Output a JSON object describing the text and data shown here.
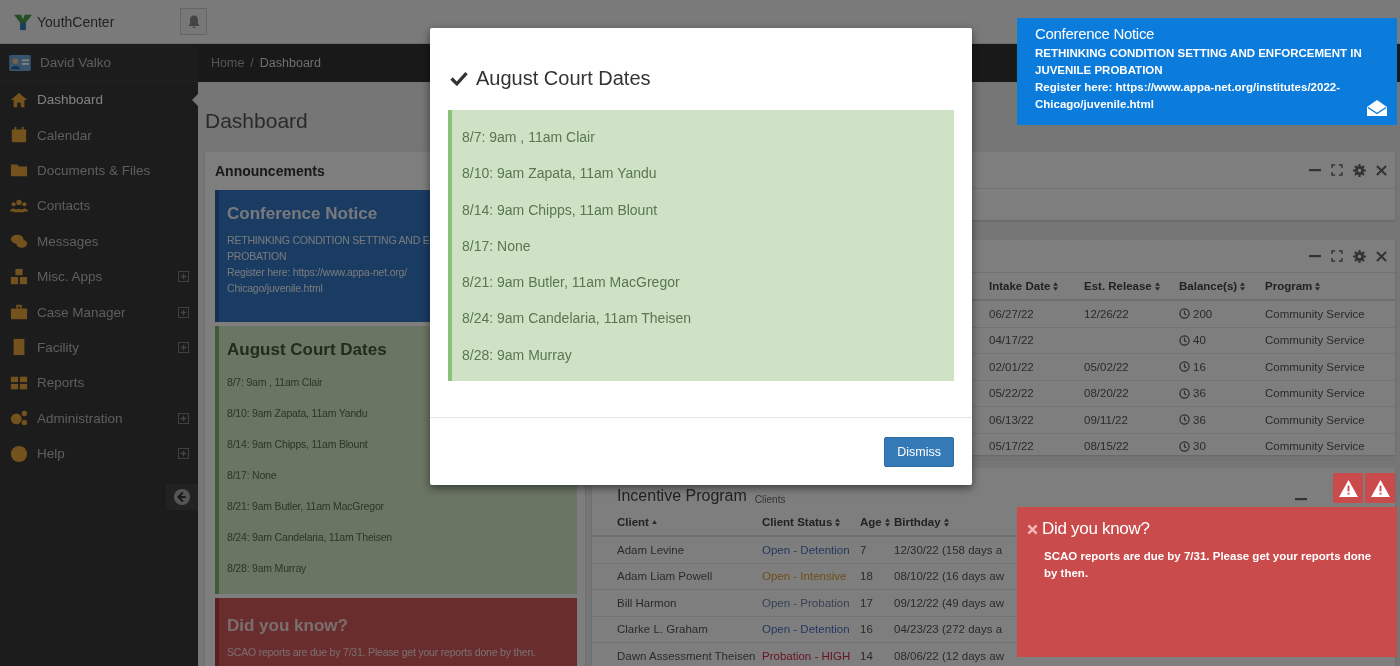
{
  "app": {
    "name": "YouthCenter"
  },
  "user": {
    "name": "David Valko"
  },
  "sidebar": {
    "items": [
      {
        "label": "Dashboard",
        "selected": true,
        "expandable": false
      },
      {
        "label": "Calendar",
        "selected": false,
        "expandable": false
      },
      {
        "label": "Documents & Files",
        "selected": false,
        "expandable": false
      },
      {
        "label": "Contacts",
        "selected": false,
        "expandable": false
      },
      {
        "label": "Messages",
        "selected": false,
        "expandable": false
      },
      {
        "label": "Misc. Apps",
        "selected": false,
        "expandable": true
      },
      {
        "label": "Case Manager",
        "selected": false,
        "expandable": true
      },
      {
        "label": "Facility",
        "selected": false,
        "expandable": true
      },
      {
        "label": "Reports",
        "selected": false,
        "expandable": false
      },
      {
        "label": "Administration",
        "selected": false,
        "expandable": true
      },
      {
        "label": "Help",
        "selected": false,
        "expandable": true
      }
    ]
  },
  "breadcrumb": {
    "items": [
      "Home",
      "Dashboard"
    ],
    "separator": "/"
  },
  "page_title": "Dashboard",
  "announcements": {
    "title": "Announcements",
    "cards": [
      {
        "kind": "info",
        "title": "Conference Notice",
        "lines": [
          "RETHINKING CONDITION SETTING AND E",
          "PROBATION",
          "Register here: https://www.appa-net.org/",
          "Chicago/juvenile.html"
        ]
      },
      {
        "kind": "success",
        "title": "August Court Dates",
        "lines": [
          "8/7: 9am , 11am Clair",
          "8/10: 9am Zapata, 11am Yandu",
          "8/14: 9am Chipps, 11am Blount",
          "8/17: None",
          "8/21: 9am Butler, 11am MacGregor",
          "8/24: 9am Candelaria, 11am Theisen",
          "8/28: 9am Murray"
        ]
      },
      {
        "kind": "danger",
        "title": "Did you know?",
        "lines": [
          "SCAO reports are due by 7/31. Please get your reports done by then."
        ]
      }
    ]
  },
  "enrollment_table": {
    "columns": [
      {
        "label": "Intake Date",
        "sorted": false
      },
      {
        "label": "Est. Release",
        "sorted": false
      },
      {
        "label": "Balance(s)",
        "sorted": false
      },
      {
        "label": "Program",
        "sorted": false
      }
    ],
    "rows": [
      {
        "intake": "06/27/22",
        "release": "12/26/22",
        "balance": "200",
        "program": "Community Service"
      },
      {
        "intake": "04/17/22",
        "balance": "40",
        "program": "Community Service"
      },
      {
        "intake": "02/01/22",
        "release": "05/02/22",
        "balance": "16",
        "program": "Community Service"
      },
      {
        "intake": "05/22/22",
        "release": "08/20/22",
        "balance": "36",
        "program": "Community Service"
      },
      {
        "intake": "06/13/22",
        "release": "09/11/22",
        "balance": "36",
        "program": "Community Service"
      },
      {
        "intake": "05/17/22",
        "release": "08/15/22",
        "balance": "30",
        "program": "Community Service"
      }
    ]
  },
  "incentive_program": {
    "title": "Incentive Program",
    "subtitle": "Clients",
    "columns": [
      {
        "label": "Client",
        "sorted": true
      },
      {
        "label": "Client Status",
        "sorted": false
      },
      {
        "label": "Age",
        "sorted": false
      },
      {
        "label": "Birthday",
        "sorted": false
      }
    ],
    "rows": [
      {
        "client": "Adam Levine",
        "status": {
          "text": "Open - Detention",
          "kind": "detention"
        },
        "age": "7",
        "birthday": "12/30/22 (158 days a"
      },
      {
        "client": "Adam Liam Powell",
        "status": {
          "text": "Open - Intensive",
          "kind": "intensive"
        },
        "age": "18",
        "birthday": "08/10/22 (16 days aw"
      },
      {
        "client": "Bill Harmon",
        "status": {
          "text": "Open - Probation",
          "kind": "probation"
        },
        "age": "17",
        "birthday": "09/12/22 (49 days aw"
      },
      {
        "client": "Clarke L. Graham",
        "status": {
          "text": "Open - Detention",
          "kind": "detention"
        },
        "age": "16",
        "birthday": "04/23/23 (272 days a"
      },
      {
        "client": "Dawn Assessment Theisen",
        "status": {
          "text": "Probation - HIGH",
          "kind": "high"
        },
        "age": "14",
        "birthday": "08/06/22 (12 days aw"
      }
    ]
  },
  "modal": {
    "title": "August Court Dates",
    "lines": [
      "8/7: 9am , 11am Clair",
      "8/10: 9am Zapata, 11am Yandu",
      "8/14: 9am Chipps, 11am Blount",
      "8/17: None",
      "8/21: 9am Butler, 11am MacGregor",
      "8/24: 9am Candelaria, 11am Theisen",
      "8/28: 9am Murray"
    ],
    "button": "Dismiss"
  },
  "toasts": [
    {
      "kind": "info",
      "title": "Conference Notice",
      "lines": [
        "RETHINKING CONDITION SETTING AND ENFORCEMENT IN JUVENILE PROBATION",
        "Register here: https://www.appa-net.org/institutes/2022-Chicago/juvenile.html"
      ]
    },
    {
      "kind": "danger",
      "title": "Did you know?",
      "lines": [
        "SCAO reports are due by 7/31. Please get your reports done by then."
      ]
    }
  ]
}
